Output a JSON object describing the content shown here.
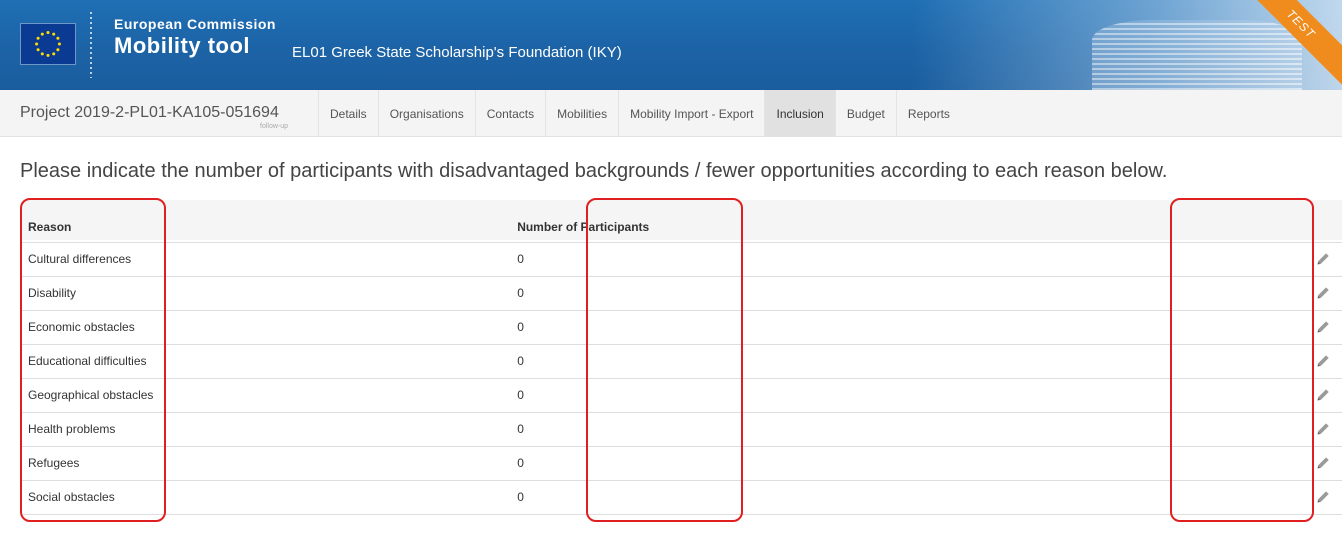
{
  "header": {
    "brand_top": "European Commission",
    "brand_main": "Mobility tool",
    "organisation": "EL01 Greek State Scholarship's Foundation (IKY)",
    "test_badge": "TEST"
  },
  "project": {
    "title": "Project 2019-2-PL01-KA105-051694",
    "subtitle": "follow-up"
  },
  "tabs": [
    {
      "label": "Details"
    },
    {
      "label": "Organisations"
    },
    {
      "label": "Contacts"
    },
    {
      "label": "Mobilities"
    },
    {
      "label": "Mobility Import - Export"
    },
    {
      "label": "Inclusion"
    },
    {
      "label": "Budget"
    },
    {
      "label": "Reports"
    }
  ],
  "active_tab": "Inclusion",
  "instructions": "Please indicate the number of participants with disadvantaged backgrounds / fewer opportunities according to each reason below.",
  "table": {
    "columns": [
      "Reason",
      "Number of Participants",
      ""
    ],
    "rows": [
      {
        "reason": "Cultural differences",
        "count": "0"
      },
      {
        "reason": "Disability",
        "count": "0"
      },
      {
        "reason": "Economic obstacles",
        "count": "0"
      },
      {
        "reason": "Educational difficulties",
        "count": "0"
      },
      {
        "reason": "Geographical obstacles",
        "count": "0"
      },
      {
        "reason": "Health problems",
        "count": "0"
      },
      {
        "reason": "Refugees",
        "count": "0"
      },
      {
        "reason": "Social obstacles",
        "count": "0"
      }
    ],
    "row_action_icon": "pencil-icon"
  },
  "colors": {
    "banner": "#1c63a6",
    "highlight": "#e02020",
    "test_ribbon": "#f08c1e"
  }
}
